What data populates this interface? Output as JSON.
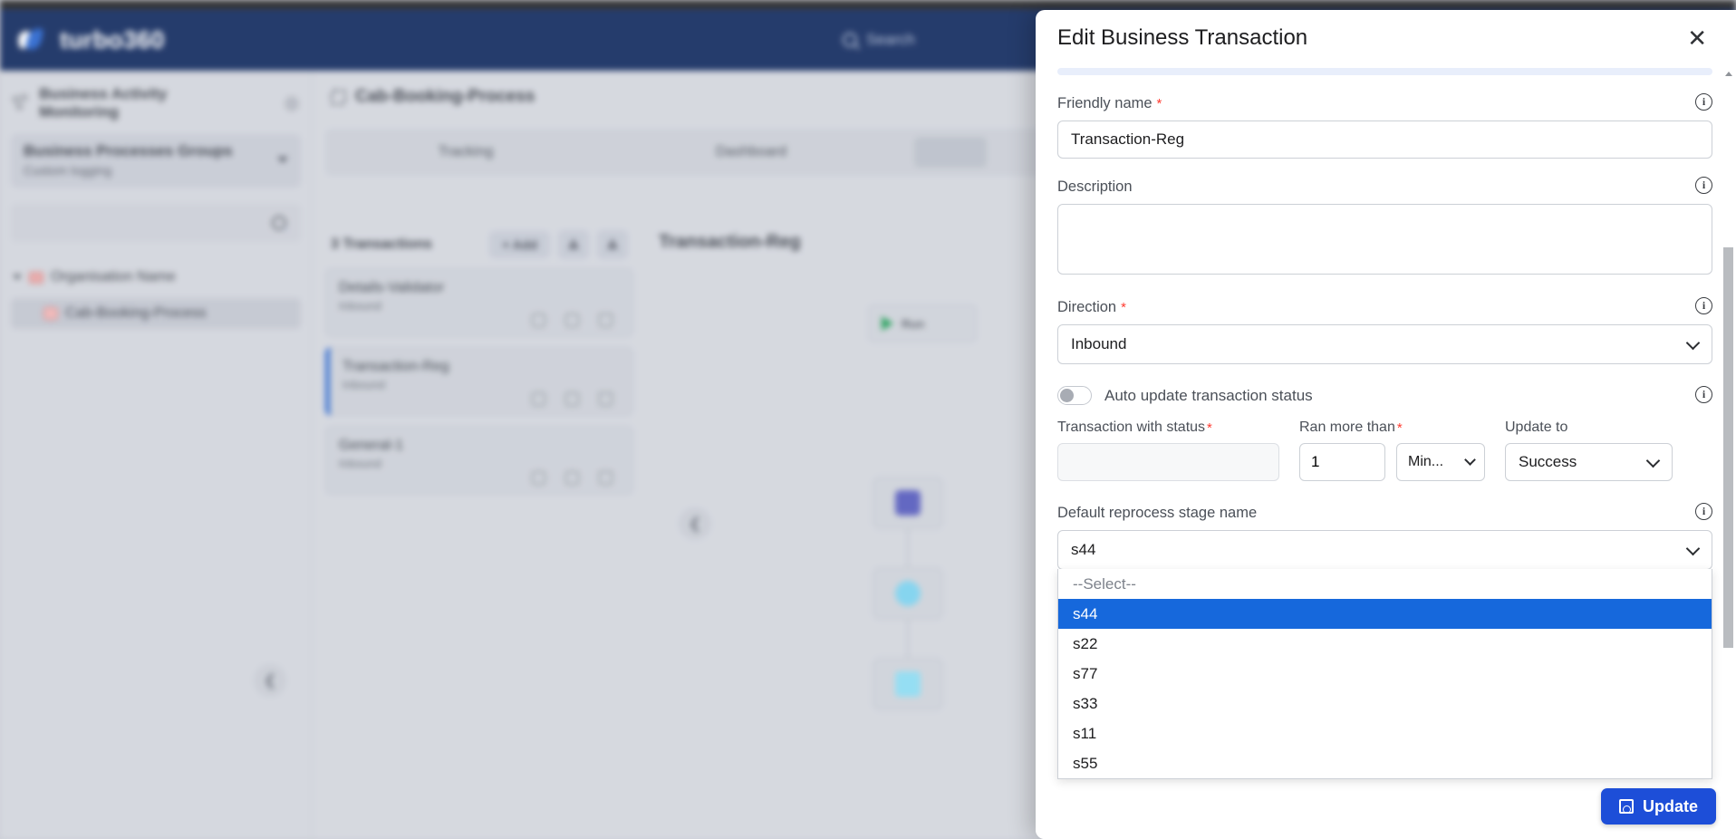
{
  "app": {
    "brand": "turbo360",
    "search_placeholder": "Search",
    "logo_icon": "turbo360-bird-logo"
  },
  "sidebar": {
    "section_title": "Business Activity Monitoring",
    "group_selector": {
      "title": "Business Processes Groups",
      "subtitle": "Custom logging"
    },
    "search_placeholder": "",
    "tree": [
      {
        "label": "Organisation Name",
        "level": 0
      },
      {
        "label": "Cab-Booking-Process",
        "level": 1
      }
    ]
  },
  "content": {
    "breadcrumb": "Cab-Booking-Process",
    "tabs": [
      {
        "label": "Tracking"
      },
      {
        "label": "Dashboard"
      }
    ],
    "transactions_header": "3 Transactions",
    "add_button": "+ Add",
    "transactions": [
      {
        "name": "Details-Validator",
        "direction": "Inbound",
        "selected": false
      },
      {
        "name": "Transaction-Reg",
        "direction": "Inbound",
        "selected": true
      },
      {
        "name": "General-1",
        "direction": "Inbound",
        "selected": false
      }
    ],
    "canvas_title": "Transaction-Reg",
    "run_label": "Run"
  },
  "panel": {
    "title": "Edit Business Transaction",
    "close_label": "✕",
    "friendly_name": {
      "label": "Friendly name",
      "required": true,
      "value": "Transaction-Reg"
    },
    "description": {
      "label": "Description",
      "value": "",
      "placeholder": ""
    },
    "direction": {
      "label": "Direction",
      "required": true,
      "value": "Inbound"
    },
    "auto_update": {
      "label": "Auto update transaction status",
      "enabled": false
    },
    "transaction_with_status": {
      "label": "Transaction with status",
      "required": true,
      "value": ""
    },
    "ran_more_than": {
      "label": "Ran more than",
      "required": true,
      "value": "1",
      "unit": "Min..."
    },
    "update_to": {
      "label": "Update to",
      "value": "Success"
    },
    "default_reprocess_stage": {
      "label": "Default reprocess stage name",
      "value": "s44",
      "options": [
        "--Select--",
        "s44",
        "s22",
        "s77",
        "s33",
        "s11",
        "s55"
      ],
      "selected_index": 1
    },
    "update_button": "Update",
    "info_icon": "i"
  },
  "colors": {
    "accent": "#1d4ed8",
    "highlight": "#1668dc",
    "topbar": "#183063",
    "required": "#ff3b30"
  }
}
